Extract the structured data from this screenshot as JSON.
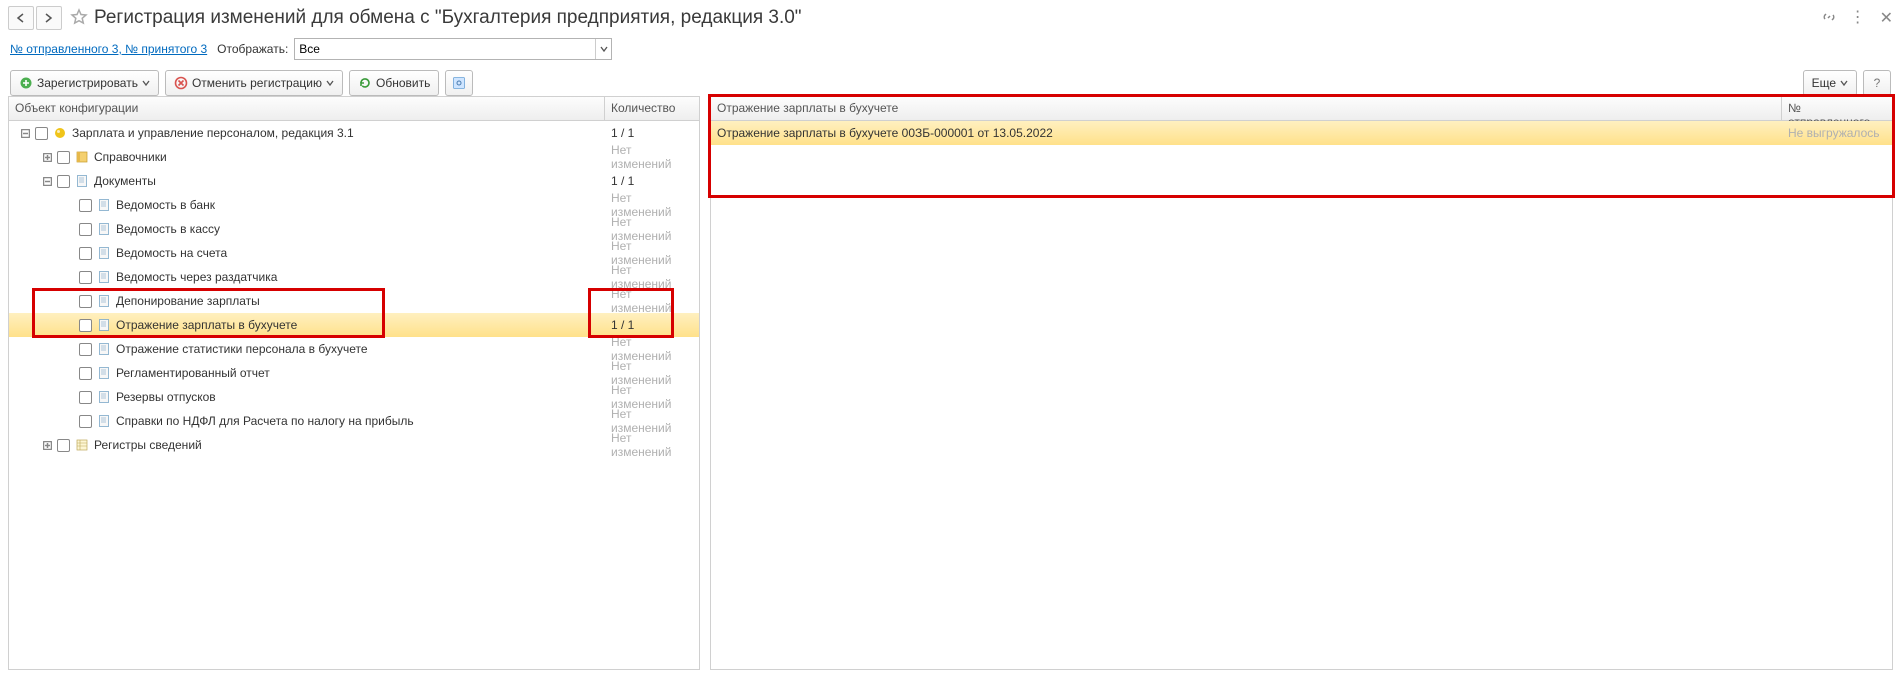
{
  "title": "Регистрация изменений для обмена с  \"Бухгалтерия предприятия, редакция 3.0\"",
  "links": {
    "sent_received": "№ отправленного 3, № принятого 3"
  },
  "filter": {
    "label": "Отображать:",
    "value": "Все"
  },
  "toolbar": {
    "register": "Зарегистрировать",
    "cancel_reg": "Отменить регистрацию",
    "refresh": "Обновить",
    "more": "Еще"
  },
  "left_cols": {
    "c1": "Объект конфигурации",
    "c2": "Количество"
  },
  "tree": [
    {
      "indent": 0,
      "exp": "minus",
      "icon": "ball",
      "label": "Зарплата и управление персоналом, редакция 3.1",
      "count": "1 / 1"
    },
    {
      "indent": 1,
      "exp": "plus",
      "icon": "book",
      "label": "Справочники",
      "count": "Нет изменений",
      "dim": true
    },
    {
      "indent": 1,
      "exp": "minus",
      "icon": "doc",
      "label": "Документы",
      "count": "1 / 1"
    },
    {
      "indent": 2,
      "exp": "",
      "icon": "doc",
      "label": "Ведомость в банк",
      "count": "Нет изменений",
      "dim": true
    },
    {
      "indent": 2,
      "exp": "",
      "icon": "doc",
      "label": "Ведомость в кассу",
      "count": "Нет изменений",
      "dim": true
    },
    {
      "indent": 2,
      "exp": "",
      "icon": "doc",
      "label": "Ведомость на счета",
      "count": "Нет изменений",
      "dim": true
    },
    {
      "indent": 2,
      "exp": "",
      "icon": "doc",
      "label": "Ведомость через раздатчика",
      "count": "Нет изменений",
      "dim": true
    },
    {
      "indent": 2,
      "exp": "",
      "icon": "doc",
      "label": "Депонирование зарплаты",
      "count": "Нет изменений",
      "dim": true
    },
    {
      "indent": 2,
      "exp": "",
      "icon": "doc",
      "label": "Отражение зарплаты в бухучете",
      "count": "1 / 1",
      "selected": true
    },
    {
      "indent": 2,
      "exp": "",
      "icon": "doc",
      "label": "Отражение статистики персонала в бухучете",
      "count": "Нет изменений",
      "dim": true
    },
    {
      "indent": 2,
      "exp": "",
      "icon": "doc",
      "label": "Регламентированный отчет",
      "count": "Нет изменений",
      "dim": true
    },
    {
      "indent": 2,
      "exp": "",
      "icon": "doc",
      "label": "Резервы отпусков",
      "count": "Нет изменений",
      "dim": true
    },
    {
      "indent": 2,
      "exp": "",
      "icon": "doc",
      "label": "Справки по НДФЛ для Расчета по налогу на прибыль",
      "count": "Нет изменений",
      "dim": true
    },
    {
      "indent": 1,
      "exp": "plus",
      "icon": "reg",
      "label": "Регистры сведений",
      "count": "Нет изменений",
      "dim": true
    }
  ],
  "right_cols": {
    "c1": "Отражение зарплаты в бухучете",
    "c2": "№ отправленного"
  },
  "right_rows": [
    {
      "c1": "Отражение зарплаты в бухучете 00ЗБ-000001 от 13.05.2022",
      "c2": "Не выгружалось"
    }
  ],
  "help": "?"
}
